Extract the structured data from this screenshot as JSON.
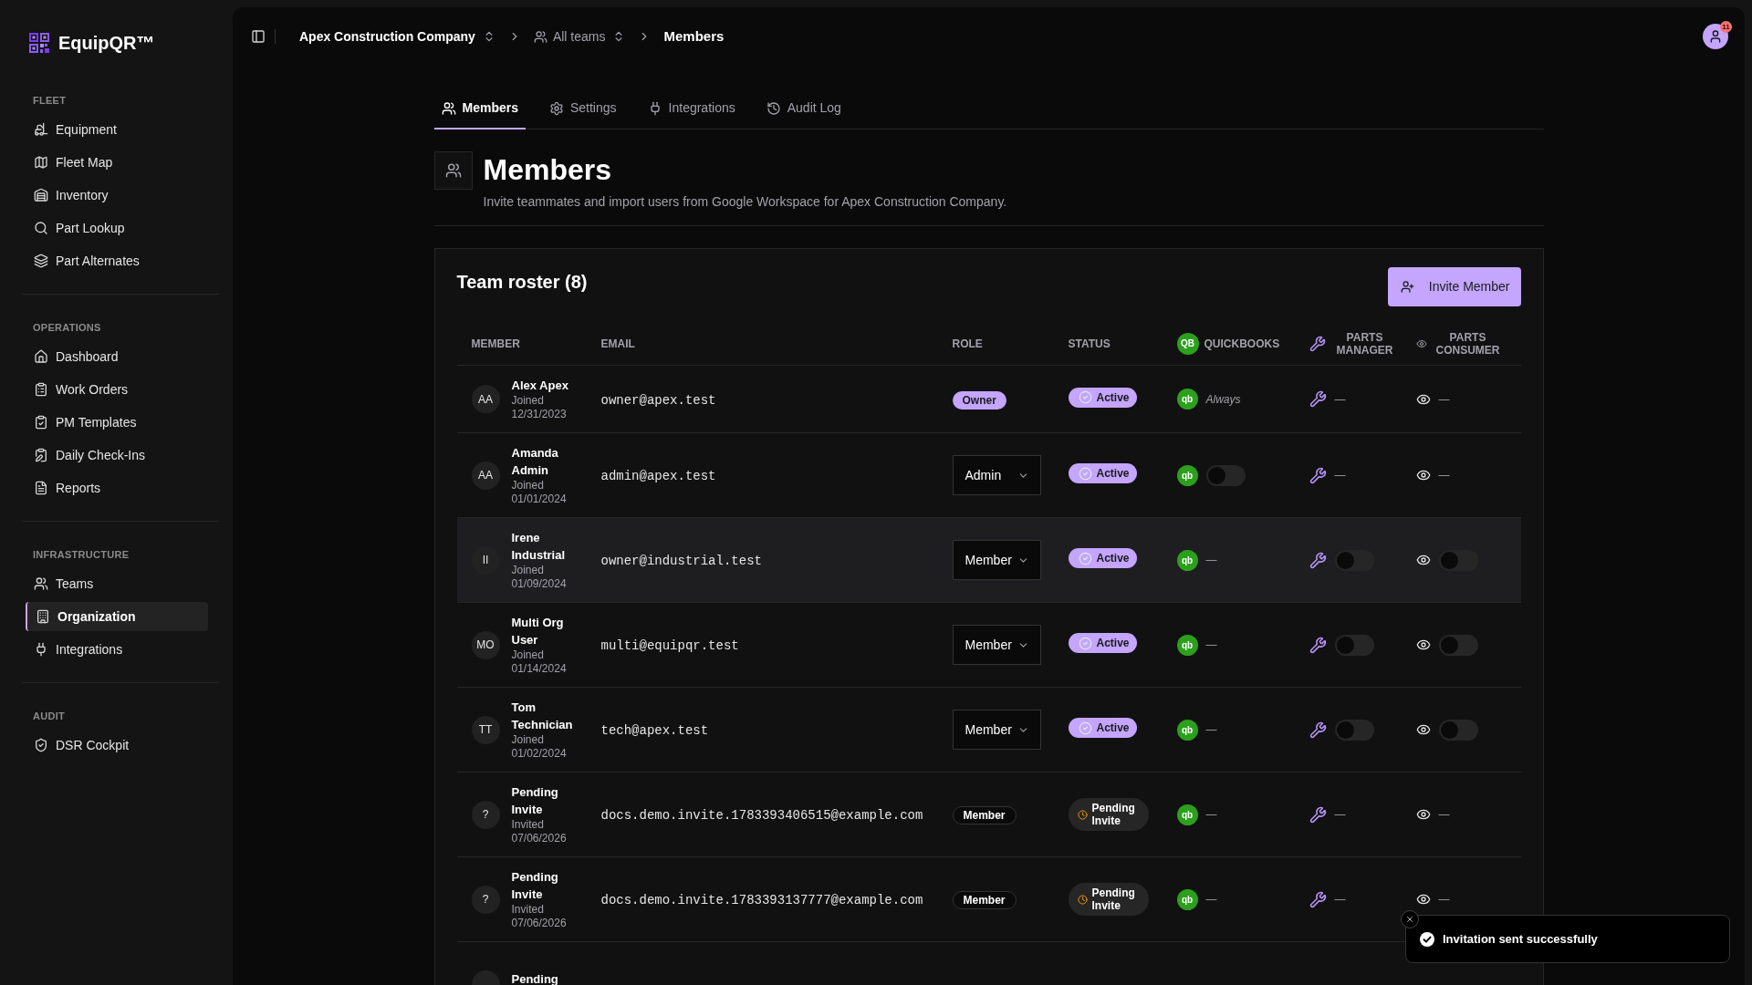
{
  "sidebar": {
    "brand": "EquipQR™",
    "sections": [
      {
        "label": "FLEET",
        "items": [
          {
            "label": "Equipment",
            "selected": false
          },
          {
            "label": "Fleet Map",
            "selected": false
          },
          {
            "label": "Inventory",
            "selected": false
          },
          {
            "label": "Part Lookup",
            "selected": false
          },
          {
            "label": "Part Alternates",
            "selected": false
          }
        ]
      },
      {
        "label": "OPERATIONS",
        "items": [
          {
            "label": "Dashboard",
            "selected": false
          },
          {
            "label": "Work Orders",
            "selected": false
          },
          {
            "label": "PM Templates",
            "selected": false
          },
          {
            "label": "Daily Check-Ins",
            "selected": false
          },
          {
            "label": "Reports",
            "selected": false
          }
        ]
      },
      {
        "label": "INFRASTRUCTURE",
        "items": [
          {
            "label": "Teams",
            "selected": false
          },
          {
            "label": "Organization",
            "selected": true
          },
          {
            "label": "Integrations",
            "selected": false
          }
        ]
      },
      {
        "label": "AUDIT",
        "items": [
          {
            "label": "DSR Cockpit",
            "selected": false
          }
        ]
      }
    ]
  },
  "topbar": {
    "breadcrumb": [
      {
        "kind": "org",
        "label": "Apex Construction Company"
      },
      {
        "kind": "team",
        "label": "All teams"
      },
      {
        "kind": "page",
        "label": "Members"
      }
    ],
    "notification_count": "11"
  },
  "tabs": [
    {
      "label": "Members",
      "selected": true
    },
    {
      "label": "Settings",
      "selected": false
    },
    {
      "label": "Integrations",
      "selected": false
    },
    {
      "label": "Audit Log",
      "selected": false
    }
  ],
  "page_header": {
    "title": "Members",
    "subtitle": "Invite teammates and import users from Google Workspace for Apex Construction Company."
  },
  "roster": {
    "title": "Team roster (8)",
    "invite_button": "Invite Member",
    "columns": [
      {
        "label": "MEMBER"
      },
      {
        "label": "EMAIL"
      },
      {
        "label": "ROLE"
      },
      {
        "label": "STATUS"
      },
      {
        "label": "QUICKBOOKS",
        "badge": "QB"
      },
      {
        "label": "PARTS MANAGER"
      },
      {
        "label": "PARTS CONSUMER"
      }
    ],
    "rows": [
      {
        "avatar": "AA",
        "name": "Alex Apex",
        "detail": "Joined 12/31/2023",
        "email": "owner@apex.test",
        "role": {
          "kind": "filled",
          "label": "Owner"
        },
        "status": {
          "kind": "active",
          "label": "Active"
        },
        "quickbooks": {
          "badge": "qb",
          "kind": "note",
          "text": "Always"
        },
        "parts_manager": {
          "kind": "text",
          "text": "—"
        },
        "parts_consumer": {
          "kind": "text",
          "text": "—"
        },
        "highlighted": false
      },
      {
        "avatar": "AA",
        "name": "Amanda Admin",
        "detail": "Joined 01/01/2024",
        "email": "admin@apex.test",
        "role": {
          "kind": "select",
          "label": "Admin"
        },
        "status": {
          "kind": "active",
          "label": "Active"
        },
        "quickbooks": {
          "badge": "qb",
          "kind": "toggle",
          "on": false
        },
        "parts_manager": {
          "kind": "text",
          "text": "—"
        },
        "parts_consumer": {
          "kind": "text",
          "text": "—"
        },
        "highlighted": false
      },
      {
        "avatar": "II",
        "name": "Irene Industrial",
        "detail": "Joined 01/09/2024",
        "email": "owner@industrial.test",
        "role": {
          "kind": "select",
          "label": "Member"
        },
        "status": {
          "kind": "active",
          "label": "Active"
        },
        "quickbooks": {
          "badge": "qb",
          "kind": "text",
          "text": "—"
        },
        "parts_manager": {
          "kind": "toggle",
          "on": false
        },
        "parts_consumer": {
          "kind": "toggle",
          "on": false
        },
        "highlighted": true
      },
      {
        "avatar": "MO",
        "name": "Multi Org User",
        "detail": "Joined 01/14/2024",
        "email": "multi@equipqr.test",
        "role": {
          "kind": "select",
          "label": "Member"
        },
        "status": {
          "kind": "active",
          "label": "Active"
        },
        "quickbooks": {
          "badge": "qb",
          "kind": "text",
          "text": "—"
        },
        "parts_manager": {
          "kind": "toggle",
          "on": false
        },
        "parts_consumer": {
          "kind": "toggle",
          "on": false
        },
        "highlighted": false
      },
      {
        "avatar": "TT",
        "name": "Tom Technician",
        "detail": "Joined 01/02/2024",
        "email": "tech@apex.test",
        "role": {
          "kind": "select",
          "label": "Member"
        },
        "status": {
          "kind": "active",
          "label": "Active"
        },
        "quickbooks": {
          "badge": "qb",
          "kind": "text",
          "text": "—"
        },
        "parts_manager": {
          "kind": "toggle",
          "on": false
        },
        "parts_consumer": {
          "kind": "toggle",
          "on": false
        },
        "highlighted": false
      },
      {
        "avatar": "?",
        "name": "Pending Invite",
        "detail": "Invited 07/06/2026",
        "email": "docs.demo.invite.1783393406515@example.com",
        "role": {
          "kind": "outline",
          "label": "Member"
        },
        "status": {
          "kind": "pending",
          "label": "Pending Invite"
        },
        "quickbooks": {
          "badge": "qb",
          "kind": "text",
          "text": "—"
        },
        "parts_manager": {
          "kind": "text",
          "text": "—"
        },
        "parts_consumer": {
          "kind": "text",
          "text": "—"
        },
        "highlighted": false
      },
      {
        "avatar": "?",
        "name": "Pending Invite",
        "detail": "Invited 07/06/2026",
        "email": "docs.demo.invite.1783393137777@example.com",
        "role": {
          "kind": "outline",
          "label": "Member"
        },
        "status": {
          "kind": "pending",
          "label": "Pending Invite"
        },
        "quickbooks": {
          "badge": "qb",
          "kind": "text",
          "text": "—"
        },
        "parts_manager": {
          "kind": "text",
          "text": "—"
        },
        "parts_consumer": {
          "kind": "text",
          "text": "—"
        },
        "highlighted": false
      },
      {
        "name": "Pending",
        "highlighted": false
      }
    ]
  },
  "toast": {
    "message": "Invitation sent successfully"
  }
}
